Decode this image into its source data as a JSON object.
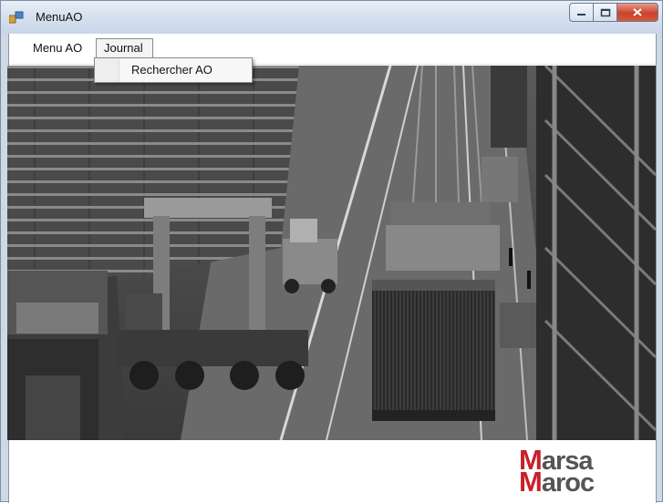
{
  "window": {
    "title": "MenuAO",
    "controls": [
      "minimize",
      "maximize",
      "close"
    ]
  },
  "menubar": {
    "items": [
      {
        "label": "Menu AO",
        "active": false
      },
      {
        "label": "Journal",
        "active": true
      }
    ]
  },
  "dropdown": {
    "parent": "Journal",
    "items": [
      {
        "label": "Rechercher AO"
      }
    ]
  },
  "background_image": {
    "description_icon": "port-container-terminal-photo",
    "tone": "grayscale"
  },
  "logo": {
    "line1_initial": "M",
    "line1_rest": "arsa",
    "line2_initial": "M",
    "line2_rest": "aroc",
    "colors": {
      "initial": "#c8202a",
      "rest": "#555555"
    }
  }
}
